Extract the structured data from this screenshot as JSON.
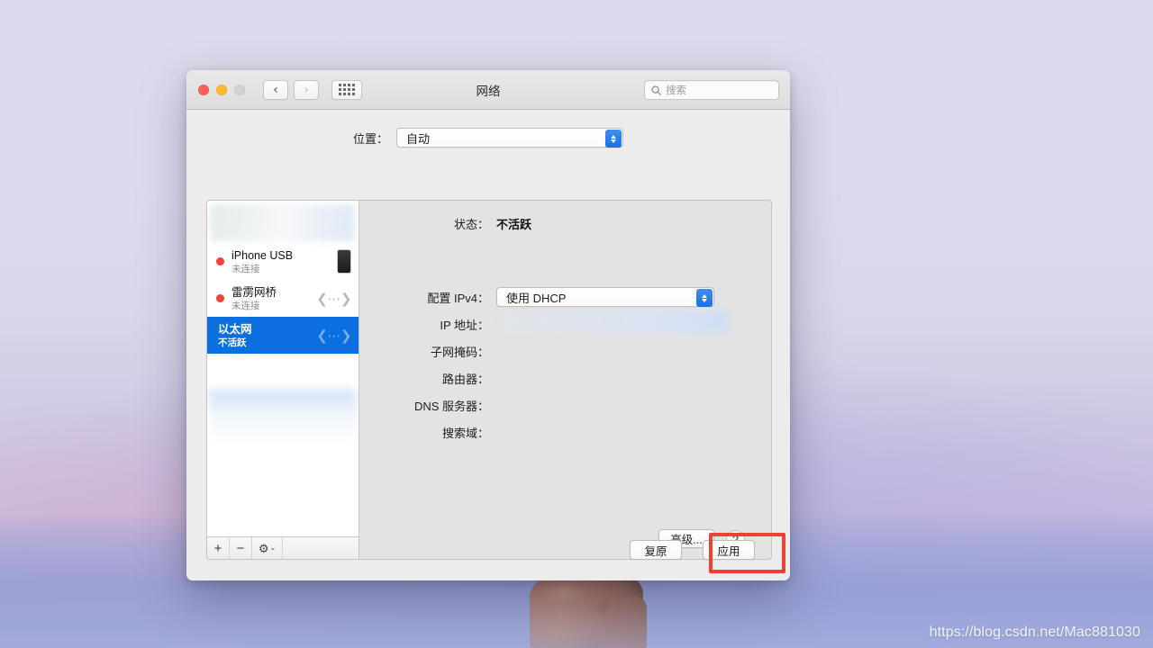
{
  "window": {
    "title": "网络",
    "traffic_lights": [
      "close-button",
      "minimize-button",
      "zoom-button"
    ],
    "nav": {
      "back": "‹",
      "forward": "›"
    },
    "grid_button": "grid-view-button",
    "search": {
      "placeholder": "搜索",
      "value": "",
      "icon": "search-icon"
    }
  },
  "location": {
    "label": "位置：",
    "selected": "自动"
  },
  "sidebar": {
    "interfaces": [
      {
        "name": "",
        "status": "",
        "dot": "",
        "icon": "redacted",
        "selected": false,
        "redacted": true
      },
      {
        "name": "iPhone USB",
        "status": "未连接",
        "dot": "#f6443a",
        "icon": "iphone-icon",
        "selected": false
      },
      {
        "name": "雷雳网桥",
        "status": "未连接",
        "dot": "#f6443a",
        "icon": "thunderbolt-icon",
        "selected": false
      },
      {
        "name": "以太网",
        "status": "不活跃",
        "dot": "",
        "icon": "thunderbolt-icon",
        "selected": true
      }
    ],
    "toolbar": {
      "add": "+",
      "remove": "−",
      "gear": "⚙",
      "gear_chevron": "⌄"
    }
  },
  "detail": {
    "status_label": "状态：",
    "status_value": "不活跃",
    "ipv4_label": "配置 IPv4：",
    "ipv4_value": "使用 DHCP",
    "fields": [
      {
        "label": "IP 地址：",
        "value": ""
      },
      {
        "label": "子网掩码：",
        "value": ""
      },
      {
        "label": "路由器：",
        "value": ""
      },
      {
        "label": "DNS 服务器：",
        "value": ""
      },
      {
        "label": "搜索域：",
        "value": ""
      }
    ],
    "advanced_button": "高级...",
    "help_button": "?"
  },
  "footer": {
    "revert_button": "复原",
    "apply_button": "应用"
  },
  "annotation": {
    "color": "#ef4136",
    "target": "apply-button"
  },
  "watermark": "https://blog.csdn.net/Mac881030"
}
